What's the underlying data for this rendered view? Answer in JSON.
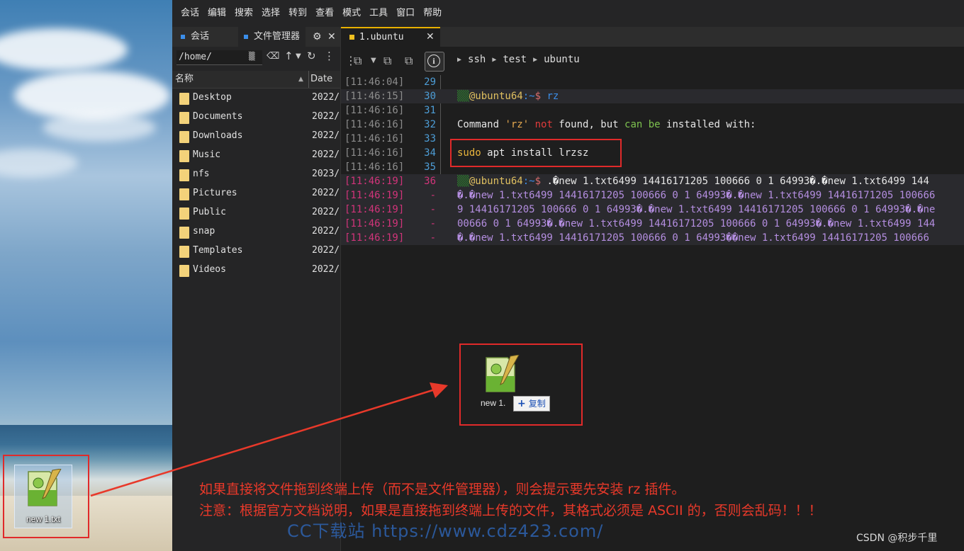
{
  "desktop": {
    "icon_label": "new 1.txt"
  },
  "menu": [
    "会话",
    "编辑",
    "搜索",
    "选择",
    "转到",
    "查看",
    "模式",
    "工具",
    "窗口",
    "帮助"
  ],
  "sidebar": {
    "tabs": [
      "会话",
      "文件管理器"
    ],
    "path": "/home/",
    "columns": {
      "name": "名称",
      "date": "Date"
    },
    "files": [
      {
        "name": "Desktop",
        "date": "2022/"
      },
      {
        "name": "Documents",
        "date": "2022/"
      },
      {
        "name": "Downloads",
        "date": "2022/"
      },
      {
        "name": "Music",
        "date": "2022/"
      },
      {
        "name": "nfs",
        "date": "2023/"
      },
      {
        "name": "Pictures",
        "date": "2022/"
      },
      {
        "name": "Public",
        "date": "2022/"
      },
      {
        "name": "snap",
        "date": "2022/"
      },
      {
        "name": "Templates",
        "date": "2022/"
      },
      {
        "name": "Videos",
        "date": "2022/"
      }
    ]
  },
  "terminal": {
    "tab_label": "1.ubuntu",
    "breadcrumb": [
      "ssh",
      "test",
      "ubuntu"
    ],
    "lines": [
      {
        "ts": "[11:46:04]",
        "no": "29",
        "type": "empty"
      },
      {
        "ts": "[11:46:15]",
        "no": "30",
        "type": "prompt",
        "cmd": "rz"
      },
      {
        "ts": "[11:46:16]",
        "no": "31",
        "type": "empty"
      },
      {
        "ts": "[11:46:16]",
        "no": "32",
        "type": "notfound"
      },
      {
        "ts": "[11:46:16]",
        "no": "33",
        "type": "empty"
      },
      {
        "ts": "[11:46:16]",
        "no": "34",
        "type": "sudo"
      },
      {
        "ts": "[11:46:16]",
        "no": "35",
        "type": "empty"
      },
      {
        "ts": "[11:46:19]",
        "no": "36",
        "type": "garbage0"
      },
      {
        "ts": "[11:46:19]",
        "no": "-",
        "type": "garbage1"
      },
      {
        "ts": "[11:46:19]",
        "no": "-",
        "type": "garbage2"
      },
      {
        "ts": "[11:46:19]",
        "no": "-",
        "type": "garbage3"
      },
      {
        "ts": "[11:46:19]",
        "no": "-",
        "type": "garbage4"
      }
    ],
    "prompt_host": "@ubuntu64",
    "prompt_path": ":~",
    "prompt_sym": "$",
    "notfound": {
      "p1": "Command ",
      "p2": "'rz'",
      "p3": " not",
      "p4": " found, but ",
      "p5": "can",
      "p6": " be",
      "p7": " installed with:"
    },
    "sudo": {
      "p1": "sudo",
      "p2": " apt install lrzsz"
    },
    "garbage": [
      " .\u0000new 1.txt6499 14416171205 100666 0 1 64993\u0000.\u0000new 1.txt6499 144",
      "\u0000.\u0000new 1.txt6499 14416171205 100666 0 1 64993\u0000.\u0000new 1.txt6499 14416171205 100666",
      "9 14416171205 100666 0 1 64993\u0000.\u0000new 1.txt6499 14416171205 100666 0 1 64993\u0000.\u0000ne",
      "00666 0 1 64993\u0000.\u0000new 1.txt6499 14416171205 100666 0 1 64993\u0000.\u0000new 1.txt6499 144",
      "\u0000.\u0000new 1.txt6499 14416171205 100666 0 1 64993\u0000\u0000new 1.txt6499 14416171205 100666"
    ]
  },
  "drag": {
    "label": "new 1.",
    "copy": "复制"
  },
  "annotation": {
    "line1": "如果直接将文件拖到终端上传（而不是文件管理器），则会提示要先安装 rz 插件。",
    "line2": "注意：根据官方文档说明，如果是直接拖到终端上传的文件，其格式必须是 ASCII 的，否则会乱码！！！"
  },
  "watermark": "CC下载站 https://www.cdz423.com/",
  "credit": "CSDN @积步千里",
  "colors": {
    "accent": "#e8b100",
    "highlight": "#e02a2a",
    "annotation": "#e8392a"
  }
}
